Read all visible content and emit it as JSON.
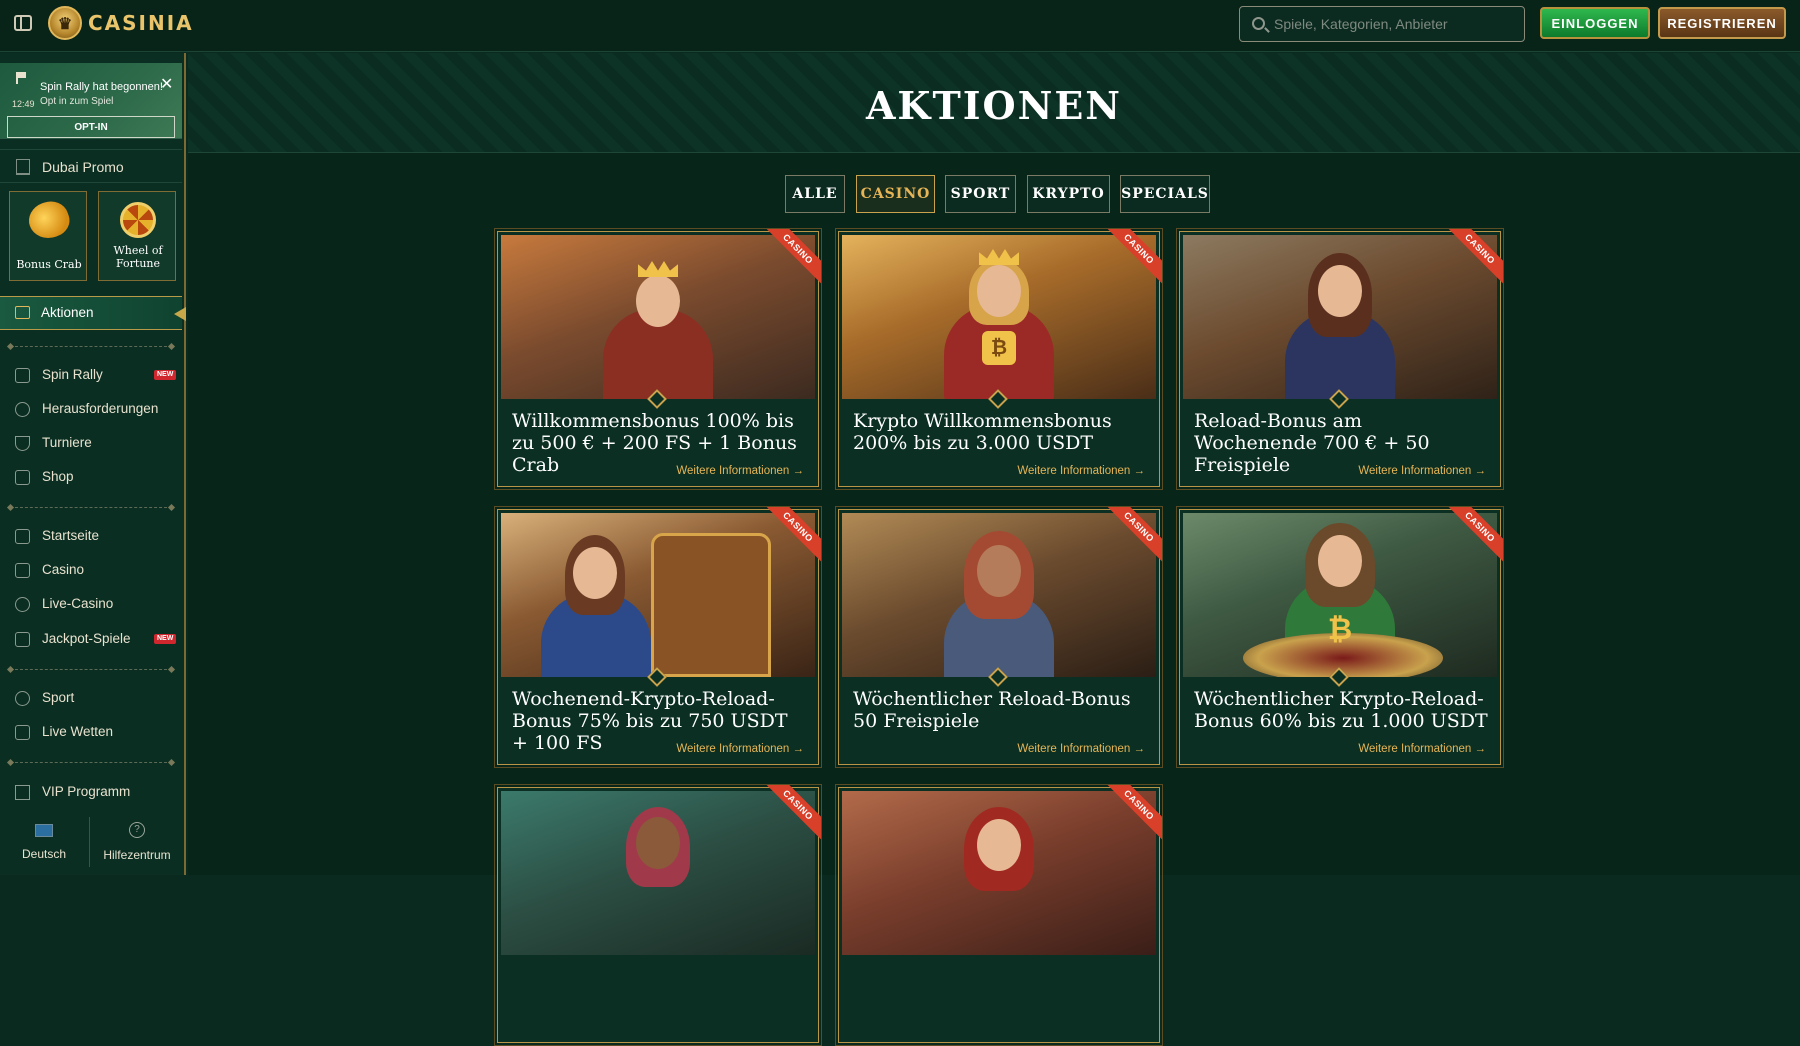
{
  "header": {
    "logo_text": "CASINIA",
    "search_placeholder": "Spiele, Kategorien, Anbieter",
    "login_label": "EINLOGGEN",
    "register_label": "REGISTRIEREN"
  },
  "sidebar": {
    "notice": {
      "title": "Spin Rally hat begonnen!",
      "subtitle": "Opt in zum Spiel",
      "time": "12:49",
      "button": "OPT-IN"
    },
    "promo_section": "Dubai Promo",
    "promo_tiles": [
      {
        "label": "Bonus Crab"
      },
      {
        "label": "Wheel of Fortune"
      }
    ],
    "active_item": "Aktionen",
    "group1": [
      {
        "label": "Spin Rally",
        "badge": "NEW"
      },
      {
        "label": "Herausforderungen"
      },
      {
        "label": "Turniere"
      },
      {
        "label": "Shop"
      }
    ],
    "group2": [
      {
        "label": "Startseite"
      },
      {
        "label": "Casino"
      },
      {
        "label": "Live-Casino"
      },
      {
        "label": "Jackpot-Spiele",
        "badge": "NEW"
      }
    ],
    "group3": [
      {
        "label": "Sport"
      },
      {
        "label": "Live Wetten"
      }
    ],
    "group4": [
      {
        "label": "VIP Programm"
      }
    ],
    "bottom": {
      "language": "Deutsch",
      "help": "Hilfezentrum"
    }
  },
  "main": {
    "title": "AKTIONEN",
    "filters": [
      "ALLE",
      "CASINO",
      "SPORT",
      "KRYPTO",
      "SPECIALS"
    ],
    "active_filter": "CASINO",
    "link_label": "Weitere Informationen →",
    "cards": [
      {
        "title": "Willkommensbonus 100% bis zu 500 € + 200 FS + 1 Bonus Crab",
        "tag": "CASINO"
      },
      {
        "title": "Krypto Willkommensbonus 200% bis zu 3.000 USDT",
        "tag": "CASINO"
      },
      {
        "title": "Reload-Bonus am Wochenende 700 € + 50 Freispiele",
        "tag": "CASINO"
      },
      {
        "title": "Wochenend-Krypto-Reload-Bonus 75% bis zu 750 USDT + 100 FS",
        "tag": "CASINO"
      },
      {
        "title": "Wöchentlicher Reload-Bonus 50 Freispiele",
        "tag": "CASINO"
      },
      {
        "title": "Wöchentlicher Krypto-Reload-Bonus 60% bis zu 1.000 USDT",
        "tag": "CASINO"
      },
      {
        "title": "",
        "tag": "CASINO"
      },
      {
        "title": "",
        "tag": "CASINO"
      }
    ]
  }
}
